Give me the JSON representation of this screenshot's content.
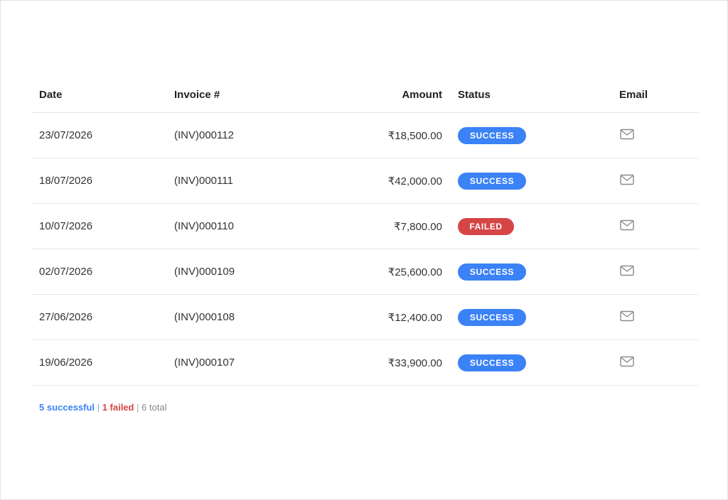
{
  "table": {
    "headers": {
      "date": "Date",
      "invoice": "Invoice #",
      "amount": "Amount",
      "status": "Status",
      "email": "Email"
    },
    "rows": [
      {
        "date": "23/07/2026",
        "invoice": "(INV)000112",
        "amount": "₹18,500.00",
        "status": "SUCCESS",
        "status_type": "success"
      },
      {
        "date": "18/07/2026",
        "invoice": "(INV)000111",
        "amount": "₹42,000.00",
        "status": "SUCCESS",
        "status_type": "success"
      },
      {
        "date": "10/07/2026",
        "invoice": "(INV)000110",
        "amount": "₹7,800.00",
        "status": "FAILED",
        "status_type": "failed"
      },
      {
        "date": "02/07/2026",
        "invoice": "(INV)000109",
        "amount": "₹25,600.00",
        "status": "SUCCESS",
        "status_type": "success"
      },
      {
        "date": "27/06/2026",
        "invoice": "(INV)000108",
        "amount": "₹12,400.00",
        "status": "SUCCESS",
        "status_type": "success"
      },
      {
        "date": "19/06/2026",
        "invoice": "(INV)000107",
        "amount": "₹33,900.00",
        "status": "SUCCESS",
        "status_type": "success"
      }
    ]
  },
  "summary": {
    "successful": "5 successful",
    "separator": "|",
    "failed": "1 failed",
    "total": "6 total"
  },
  "colors": {
    "success": "#3b82f6",
    "failed": "#d64545"
  },
  "icons": {
    "email": "envelope-icon"
  }
}
